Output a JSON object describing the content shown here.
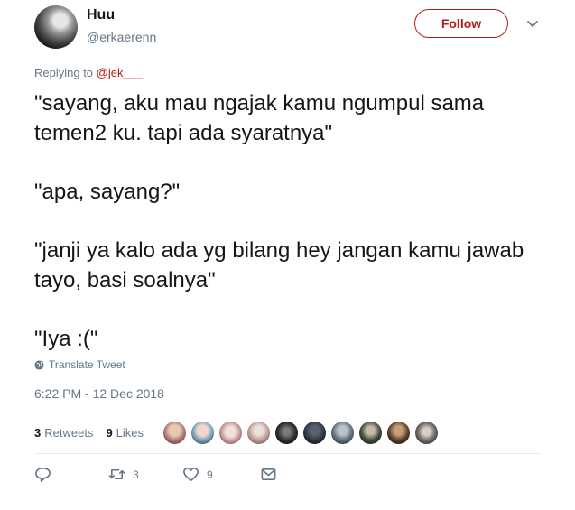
{
  "author": {
    "name": "Huu",
    "handle": "@erkaerenn"
  },
  "follow_label": "Follow",
  "reply_context": {
    "prefix": "Replying to ",
    "mention": "@jek___"
  },
  "tweet": {
    "lines": [
      "\"sayang, aku mau ngajak kamu ngumpul sama temen2 ku. tapi ada syaratnya\"",
      "\"apa, sayang?\"",
      "\"janji ya kalo ada yg bilang hey jangan kamu jawab tayo, basi soalnya\"",
      "\"Iya :(\""
    ]
  },
  "translate_label": "Translate Tweet",
  "timestamp": "6:22 PM - 12 Dec 2018",
  "stats": {
    "retweets_count": "3",
    "retweets_label": "Retweets",
    "likes_count": "9",
    "likes_label": "Likes"
  },
  "actions": {
    "retweet_count": "3",
    "like_count": "9"
  },
  "colors": {
    "accent": "#b31b1b",
    "muted": "#657786",
    "text": "#14171a",
    "divider": "#e6ecf0"
  },
  "icons": [
    "globe-icon",
    "chevron-down-icon",
    "reply-icon",
    "retweet-icon",
    "heart-icon",
    "message-icon"
  ]
}
